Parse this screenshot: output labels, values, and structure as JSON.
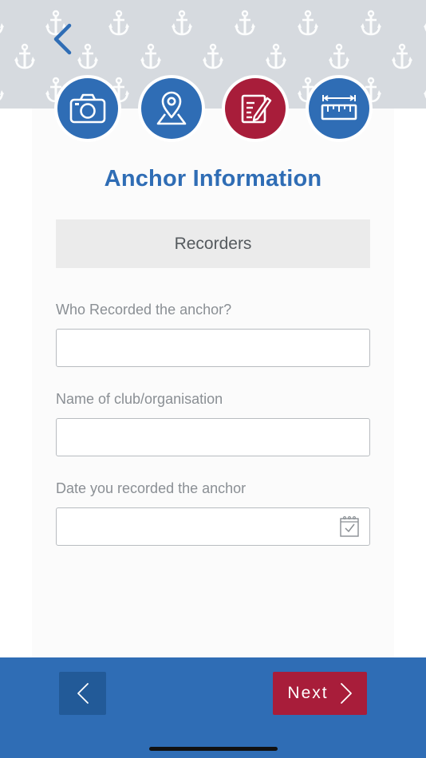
{
  "header": {
    "back_icon": "chevron-left-icon",
    "pattern_icon": "anchor-icon"
  },
  "steps": [
    {
      "icon": "camera-icon",
      "state": "complete",
      "color": "#2f6db5"
    },
    {
      "icon": "map-pin-icon",
      "state": "complete",
      "color": "#2f6db5"
    },
    {
      "icon": "edit-form-icon",
      "state": "active",
      "color": "#a81d3a"
    },
    {
      "icon": "ruler-icon",
      "state": "upcoming",
      "color": "#2f6db5"
    }
  ],
  "page": {
    "title": "Anchor Information",
    "section": "Recorders"
  },
  "form": {
    "recorded_by": {
      "label": "Who Recorded the anchor?",
      "value": "",
      "placeholder": ""
    },
    "club": {
      "label": "Name of club/organisation",
      "value": "",
      "placeholder": ""
    },
    "date": {
      "label": "Date you recorded the anchor",
      "value": "",
      "placeholder": "",
      "icon": "calendar-check-icon"
    }
  },
  "footer": {
    "prev_icon": "chevron-left-icon",
    "next_label": "Next",
    "next_icon": "chevron-right-icon"
  },
  "colors": {
    "primary_blue": "#2f6db5",
    "dark_blue": "#225a98",
    "accent_red": "#a81d3a",
    "hero_gray": "#d6dadf"
  }
}
